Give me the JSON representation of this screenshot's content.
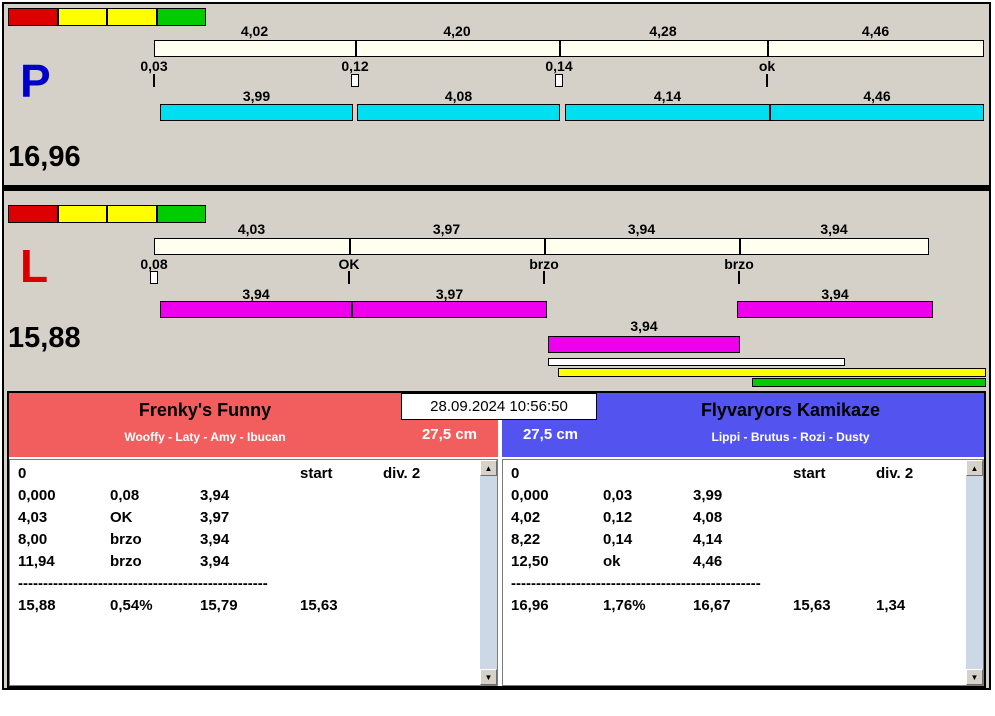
{
  "colors": {
    "window_bg": "#d5d1c9",
    "traffic": [
      "#dd0000",
      "#ffff00",
      "#ffff00",
      "#00cc00"
    ],
    "split_bar": "#fffff0",
    "p_lap_bar": "#00dff0",
    "l_lap_bar": "#ee00ee",
    "p_letter": "#0000c8",
    "l_letter": "#d60000",
    "team_left_header": "#f25e5e",
    "team_right_header": "#5353f0",
    "progress_yellow": "#ffff00",
    "progress_green": "#00cc00"
  },
  "track_p": {
    "letter": "P",
    "total": "16,96",
    "splits": [
      "4,02",
      "4,20",
      "4,28",
      "4,46"
    ],
    "changes": [
      "0,03",
      "0,12",
      "0,14",
      "ok"
    ],
    "laps": [
      "3,99",
      "4,08",
      "4,14",
      "4,46"
    ]
  },
  "track_l": {
    "letter": "L",
    "total": "15,88",
    "splits": [
      "4,03",
      "3,97",
      "3,94",
      "3,94"
    ],
    "changes": [
      "0,08",
      "OK",
      "brzo",
      "brzo"
    ],
    "laps": [
      "3,94",
      "3,97",
      "3,94"
    ],
    "extra_lap": "3,94"
  },
  "center": {
    "datetime": "28.09.2024 10:56:50",
    "left_height": "27,5 cm",
    "right_height": "27,5 cm"
  },
  "team_left": {
    "name": "Frenky's Funny",
    "dogs": "Wooffy - Laty - Amy - Ibucan",
    "table": {
      "status": "0",
      "col_start": "start",
      "col_div": "div. 2",
      "rows": [
        [
          "0,000",
          "0,08",
          "3,94"
        ],
        [
          "4,03",
          "OK",
          "3,97"
        ],
        [
          "8,00",
          "brzo",
          "3,94"
        ],
        [
          "11,94",
          "brzo",
          "3,94"
        ]
      ],
      "separator": "--------------------------------------------------",
      "summary": {
        "total": "15,88",
        "pct": "0,54%",
        "net": "15,79",
        "best": "15,63",
        "diff": ""
      }
    }
  },
  "team_right": {
    "name": "Flyvaryors Kamikaze",
    "dogs": "Lippi - Brutus - Rozi - Dusty",
    "table": {
      "status": "0",
      "col_start": "start",
      "col_div": "div. 2",
      "rows": [
        [
          "0,000",
          "0,03",
          "3,99"
        ],
        [
          "4,02",
          "0,12",
          "4,08"
        ],
        [
          "8,22",
          "0,14",
          "4,14"
        ],
        [
          "12,50",
          "ok",
          "4,46"
        ]
      ],
      "separator": "--------------------------------------------------",
      "summary": {
        "total": "16,96",
        "pct": "1,76%",
        "net": "16,67",
        "best": "15,63",
        "diff": "1,34"
      }
    }
  }
}
